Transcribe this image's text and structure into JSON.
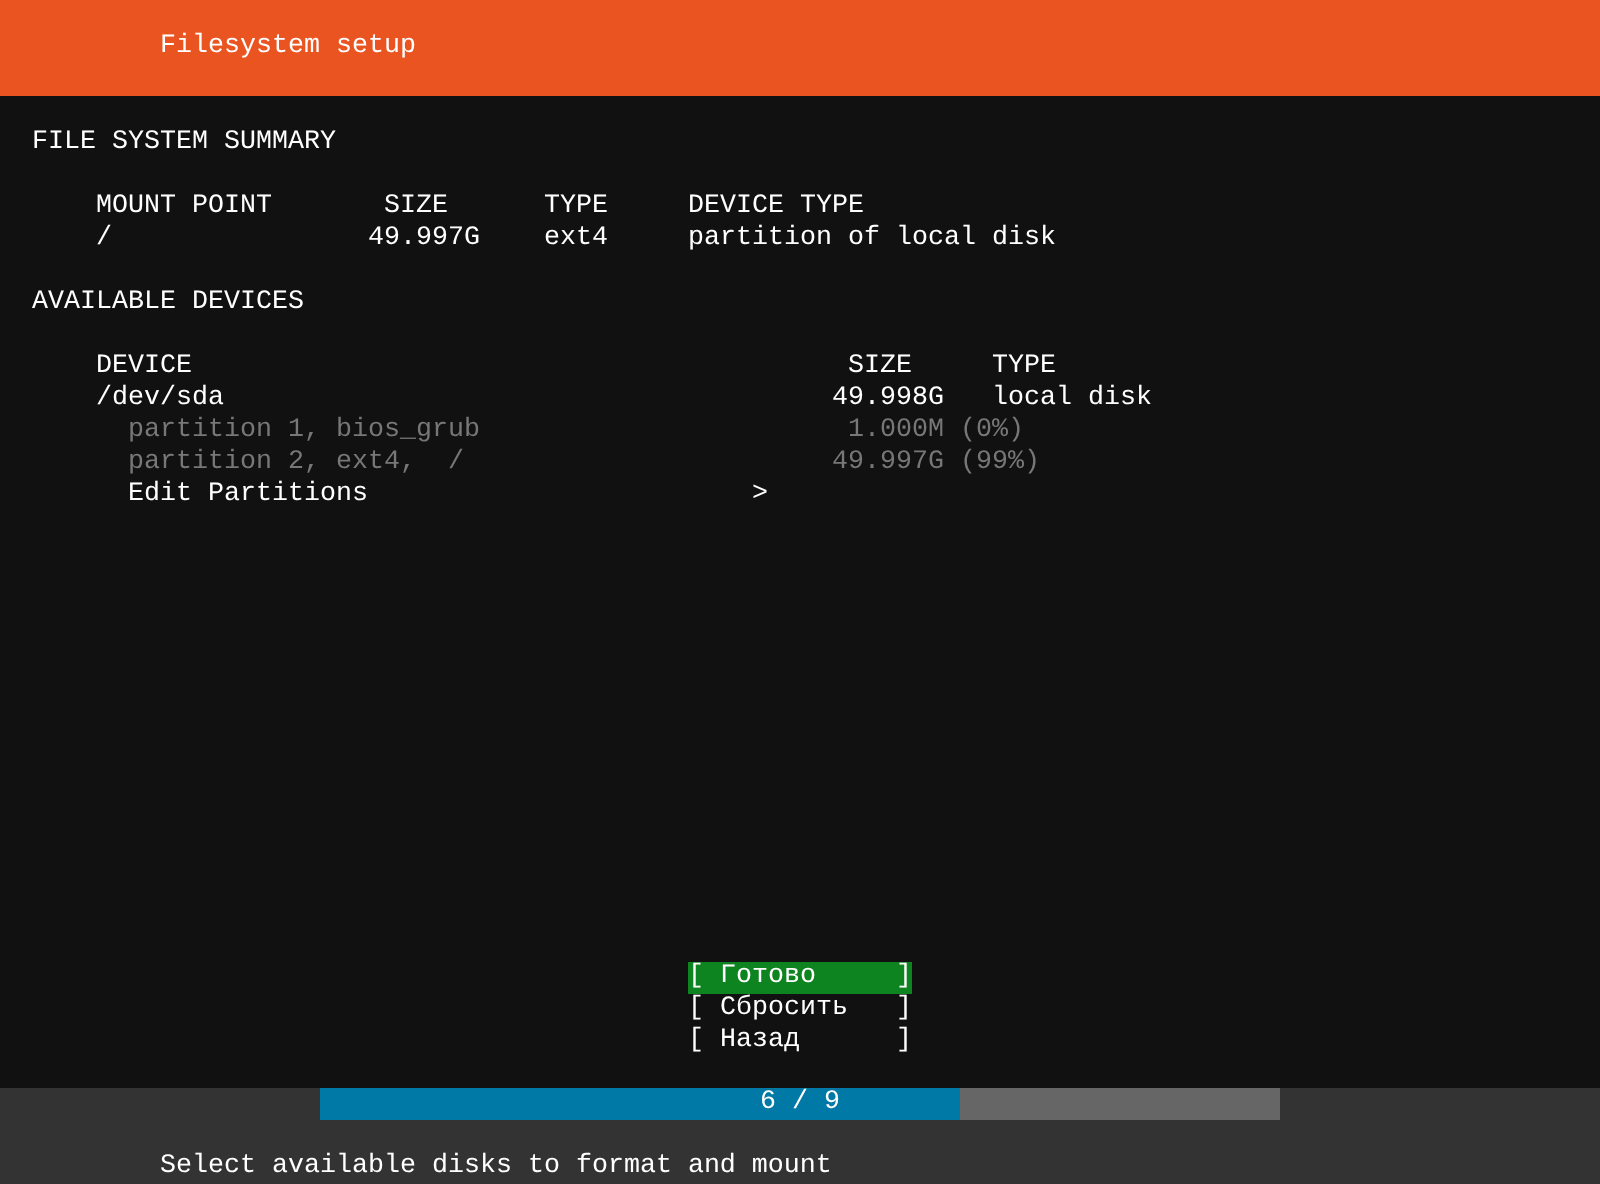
{
  "header": {
    "title": "Filesystem setup"
  },
  "summary": {
    "heading": "FILE SYSTEM SUMMARY",
    "columns": [
      "MOUNT POINT",
      "SIZE",
      "TYPE",
      "DEVICE TYPE"
    ],
    "rows": [
      {
        "mount_point": "/",
        "size": "49.997G",
        "type": "ext4",
        "device_type": "partition of local disk"
      }
    ]
  },
  "available": {
    "heading": "AVAILABLE DEVICES",
    "columns": [
      "DEVICE",
      "SIZE",
      "TYPE"
    ],
    "devices": [
      {
        "name": "/dev/sda",
        "size": "49.998G",
        "type": "local disk",
        "partitions": [
          {
            "name": "partition 1, bios_grub",
            "size": "1.000M",
            "share": "(0%)",
            "disabled": true
          },
          {
            "name": "partition 2, ext4,  /",
            "size": "49.997G",
            "share": "(99%)",
            "disabled": true
          }
        ],
        "action": {
          "label": "Edit Partitions",
          "arrow": ">"
        }
      }
    ]
  },
  "buttons": [
    {
      "label": "[ Готово     ]",
      "selected": true
    },
    {
      "label": "[ Сбросить   ]",
      "selected": false
    },
    {
      "label": "[ Назад      ]",
      "selected": false
    }
  ],
  "progress": {
    "label": "6 / 9",
    "level": 0.667
  },
  "status_bar": {
    "text": "Select available disks to format and mount"
  }
}
